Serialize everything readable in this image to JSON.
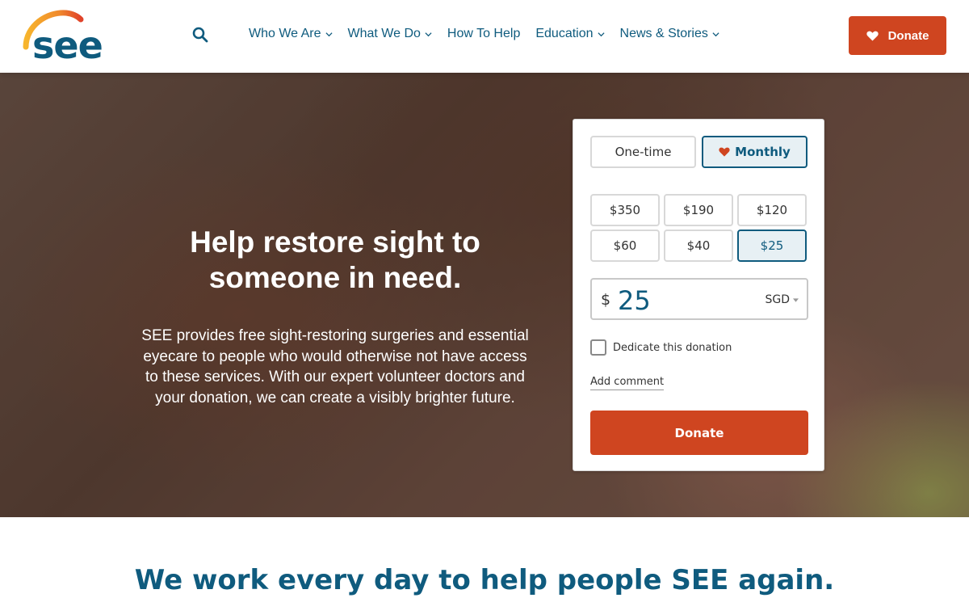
{
  "header": {
    "logo_text": "see",
    "nav": [
      {
        "label": "Who We Are",
        "has_dropdown": true
      },
      {
        "label": "What We Do",
        "has_dropdown": true
      },
      {
        "label": "How To Help",
        "has_dropdown": false
      },
      {
        "label": "Education",
        "has_dropdown": true
      },
      {
        "label": "News & Stories",
        "has_dropdown": true
      }
    ],
    "donate_label": "Donate"
  },
  "hero": {
    "title": "Help restore sight to someone in need.",
    "body": "SEE provides free sight-restoring surgeries and essential eyecare to people who would otherwise not have access to these services. With our expert volunteer doctors and your donation, we can create a visibly brighter future."
  },
  "donation_form": {
    "frequency": [
      {
        "label": "One-time",
        "selected": false
      },
      {
        "label": "Monthly",
        "selected": true
      }
    ],
    "amounts": [
      {
        "label": "$350",
        "selected": false
      },
      {
        "label": "$190",
        "selected": false
      },
      {
        "label": "$120",
        "selected": false
      },
      {
        "label": "$60",
        "selected": false
      },
      {
        "label": "$40",
        "selected": false
      },
      {
        "label": "$25",
        "selected": true
      }
    ],
    "currency_symbol": "$",
    "amount_value": "25",
    "currency": "SGD",
    "dedicate_label": "Dedicate this donation",
    "dedicate_checked": false,
    "add_comment_label": "Add comment",
    "donate_label": "Donate"
  },
  "section": {
    "heading": "We work every day to help people SEE again."
  },
  "colors": {
    "brand_blue": "#0f5b7e",
    "donate_orange": "#cf4520"
  }
}
